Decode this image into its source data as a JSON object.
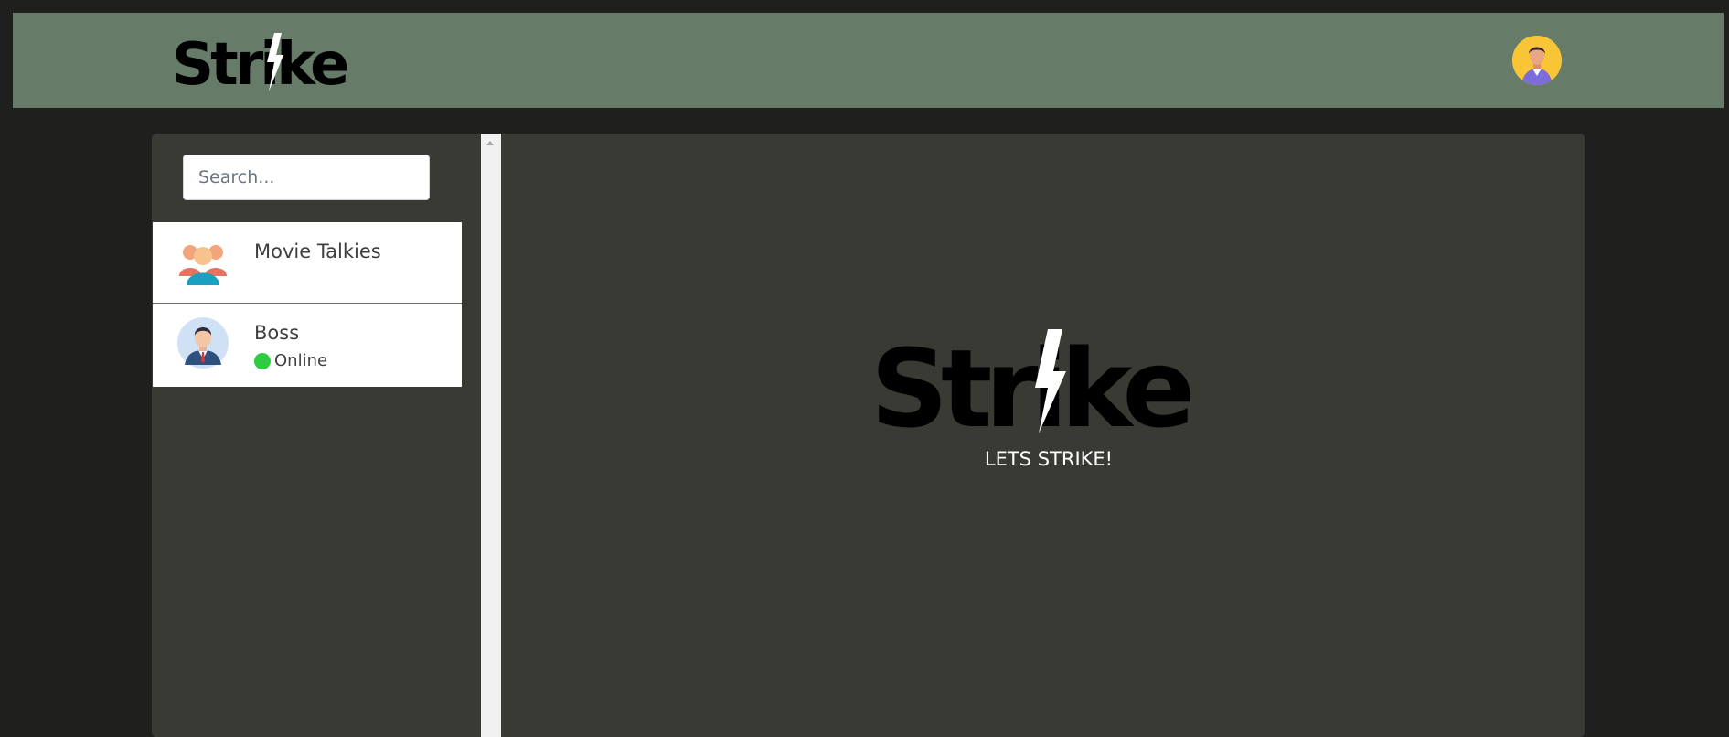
{
  "app": {
    "logo_text": "Strike"
  },
  "header": {
    "logo_icon": "strike-logo",
    "user_avatar_icon": "user-avatar-icon"
  },
  "search": {
    "placeholder": "Search..."
  },
  "chats": [
    {
      "name": "Movie Talkies",
      "icon": "group-avatar-icon",
      "status": ""
    },
    {
      "name": "Boss",
      "icon": "user-avatar-icon",
      "status": "Online",
      "status_color": "#2ecc40"
    }
  ],
  "welcome": {
    "logo_text": "Strike",
    "tagline": "LETS STRIKE!"
  },
  "colors": {
    "header_bg": "#667c69",
    "page_bg": "#1f201e",
    "panel_bg": "#3a3a34",
    "online": "#2ecc40"
  }
}
